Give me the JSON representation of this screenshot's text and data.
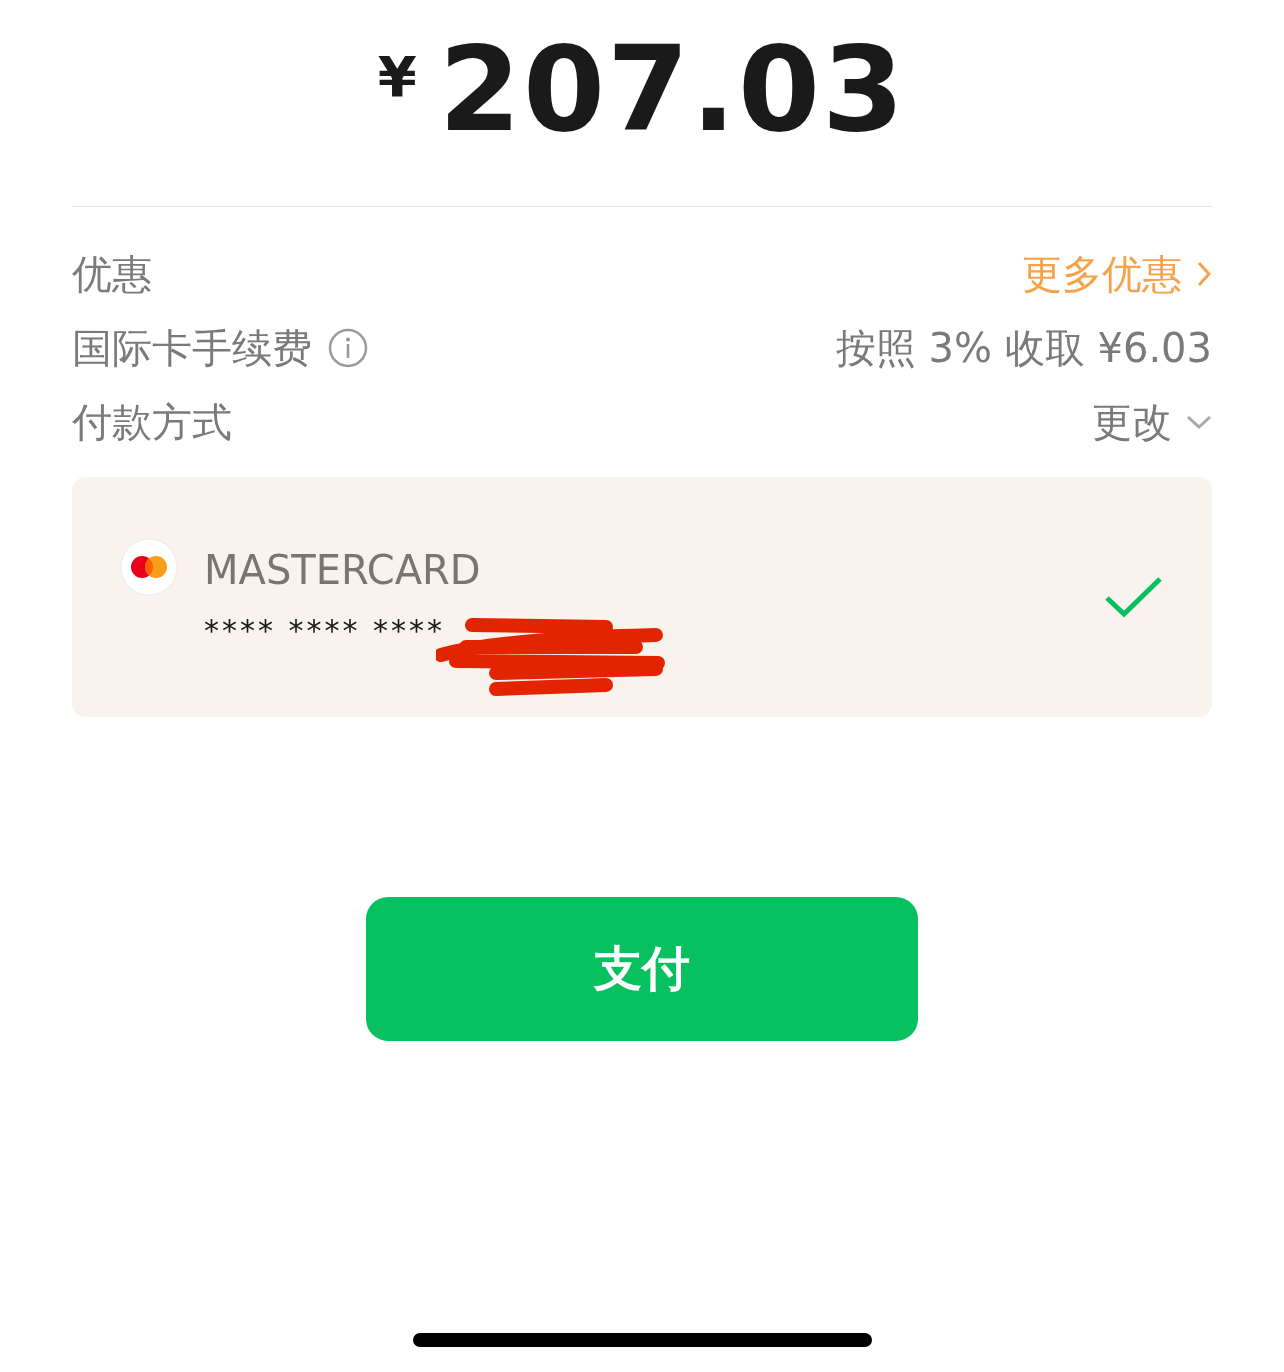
{
  "amount": {
    "currency": "¥",
    "value": "207.03"
  },
  "rows": [
    {
      "label": "优惠",
      "kind": "link",
      "value": "更多优惠"
    },
    {
      "label": "国际卡手续费",
      "kind": "info",
      "value": "按照 3% 收取 ¥6.03"
    },
    {
      "label": "付款方式",
      "kind": "dropdown",
      "value": "更改"
    }
  ],
  "card": {
    "brand": "MASTERCARD",
    "number": "**** **** ****",
    "selected": true
  },
  "pay_button": {
    "label": "支付"
  }
}
